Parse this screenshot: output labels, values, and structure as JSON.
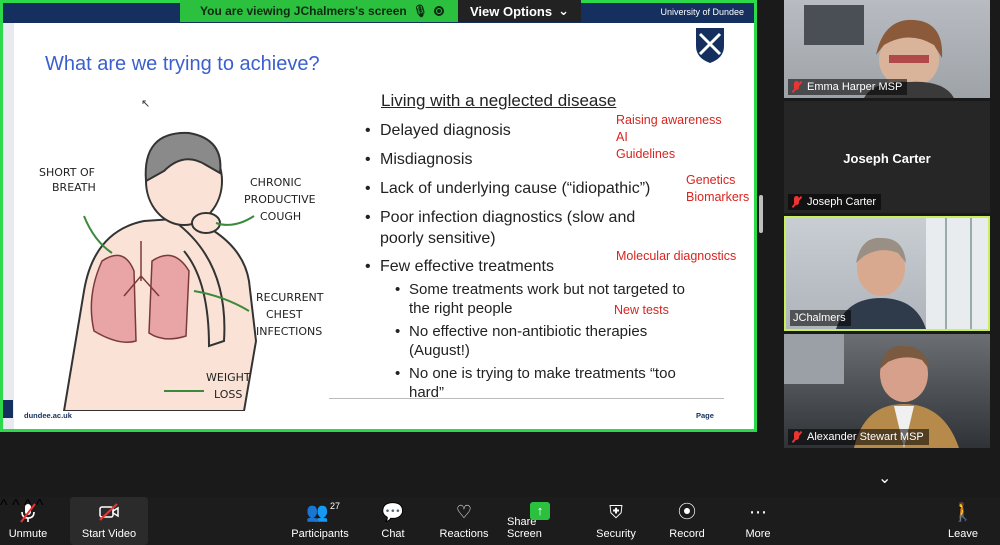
{
  "banner": {
    "viewing_text": "You are viewing  JChalmers's screen",
    "view_options": "View Options"
  },
  "slide": {
    "university": "University of Dundee",
    "title": "What are we trying to achieve?",
    "subtitle": "Living with a neglected disease",
    "bullets": [
      "Delayed diagnosis",
      "Misdiagnosis",
      "Lack of underlying cause (“idiopathic”)",
      "Poor infection diagnostics (slow and poorly sensitive)",
      "Few effective treatments"
    ],
    "sub_bullets": [
      "Some treatments work but not targeted to the right people",
      "No effective non-antibiotic therapies (August!)",
      "No one is trying to make treatments “too hard”"
    ],
    "notes": [
      "Raising awareness",
      "AI",
      "Guidelines",
      "Genetics",
      "Biomarkers",
      "Molecular diagnostics",
      "New tests"
    ],
    "illustration_labels": [
      "SHORT OF",
      "BREATH",
      "CHRONIC",
      "PRODUCTIVE",
      "COUGH",
      "RECURRENT",
      "CHEST",
      "INFECTIONS",
      "WEIGHT",
      "LOSS"
    ],
    "footer_left": "dundee.ac.uk",
    "footer_right": "Page"
  },
  "participants": [
    {
      "name": "Emma Harper MSP"
    },
    {
      "name": "Joseph Carter",
      "display": "Joseph Carter"
    },
    {
      "name": "JChalmers"
    },
    {
      "name": "Alexander Stewart MSP"
    }
  ],
  "toolbar": {
    "unmute": "Unmute",
    "start_video": "Start Video",
    "participants": "Participants",
    "participants_count": "27",
    "chat": "Chat",
    "reactions": "Reactions",
    "share_screen": "Share Screen",
    "security": "Security",
    "record": "Record",
    "more": "More",
    "leave": "Leave"
  },
  "colors": {
    "share_border": "#2bd94a",
    "accent_red": "#d9231f",
    "title_blue": "#3a5fcf",
    "active_speaker": "#c8f05a"
  }
}
